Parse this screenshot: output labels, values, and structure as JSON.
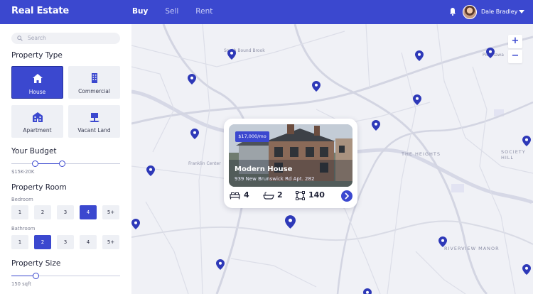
{
  "header": {
    "brand": "Real Estate",
    "nav": [
      "Buy",
      "Sell",
      "Rent"
    ],
    "active_nav": "Buy",
    "username": "Dale Bradley"
  },
  "sidebar": {
    "search_placeholder": "Search",
    "property_type_title": "Property Type",
    "types": [
      "House",
      "Commercial",
      "Apartment",
      "Vacant Land"
    ],
    "active_type": "House",
    "budget_title": "Your Budget",
    "budget_value": "$15K-20K",
    "room_title": "Property Room",
    "bedroom_label": "Bedroom",
    "bedroom_options": [
      "1",
      "2",
      "3",
      "4",
      "5+"
    ],
    "bedroom_selected": "4",
    "bathroom_label": "Bathroom",
    "bathroom_options": [
      "1",
      "2",
      "3",
      "4",
      "5+"
    ],
    "bathroom_selected": "2",
    "size_title": "Property Size",
    "size_value": "150 sqft"
  },
  "map": {
    "labels": [
      "South Bound Brook",
      "Franklin Center",
      "THE HEIGHTS",
      "SOCIETY HILL",
      "RIVERVIEW MANOR",
      "Piscatawa"
    ],
    "zoom_in": "+",
    "zoom_out": "−"
  },
  "listing": {
    "price": "$17,000/mo",
    "title": "Modern House",
    "address": "939 New Brunswick Rd Apt. 282",
    "beds": "4",
    "baths": "2",
    "area": "140"
  },
  "colors": {
    "accent": "#3b48cf",
    "map_bg": "#f0f1f6",
    "road": "#d9dbe5"
  }
}
